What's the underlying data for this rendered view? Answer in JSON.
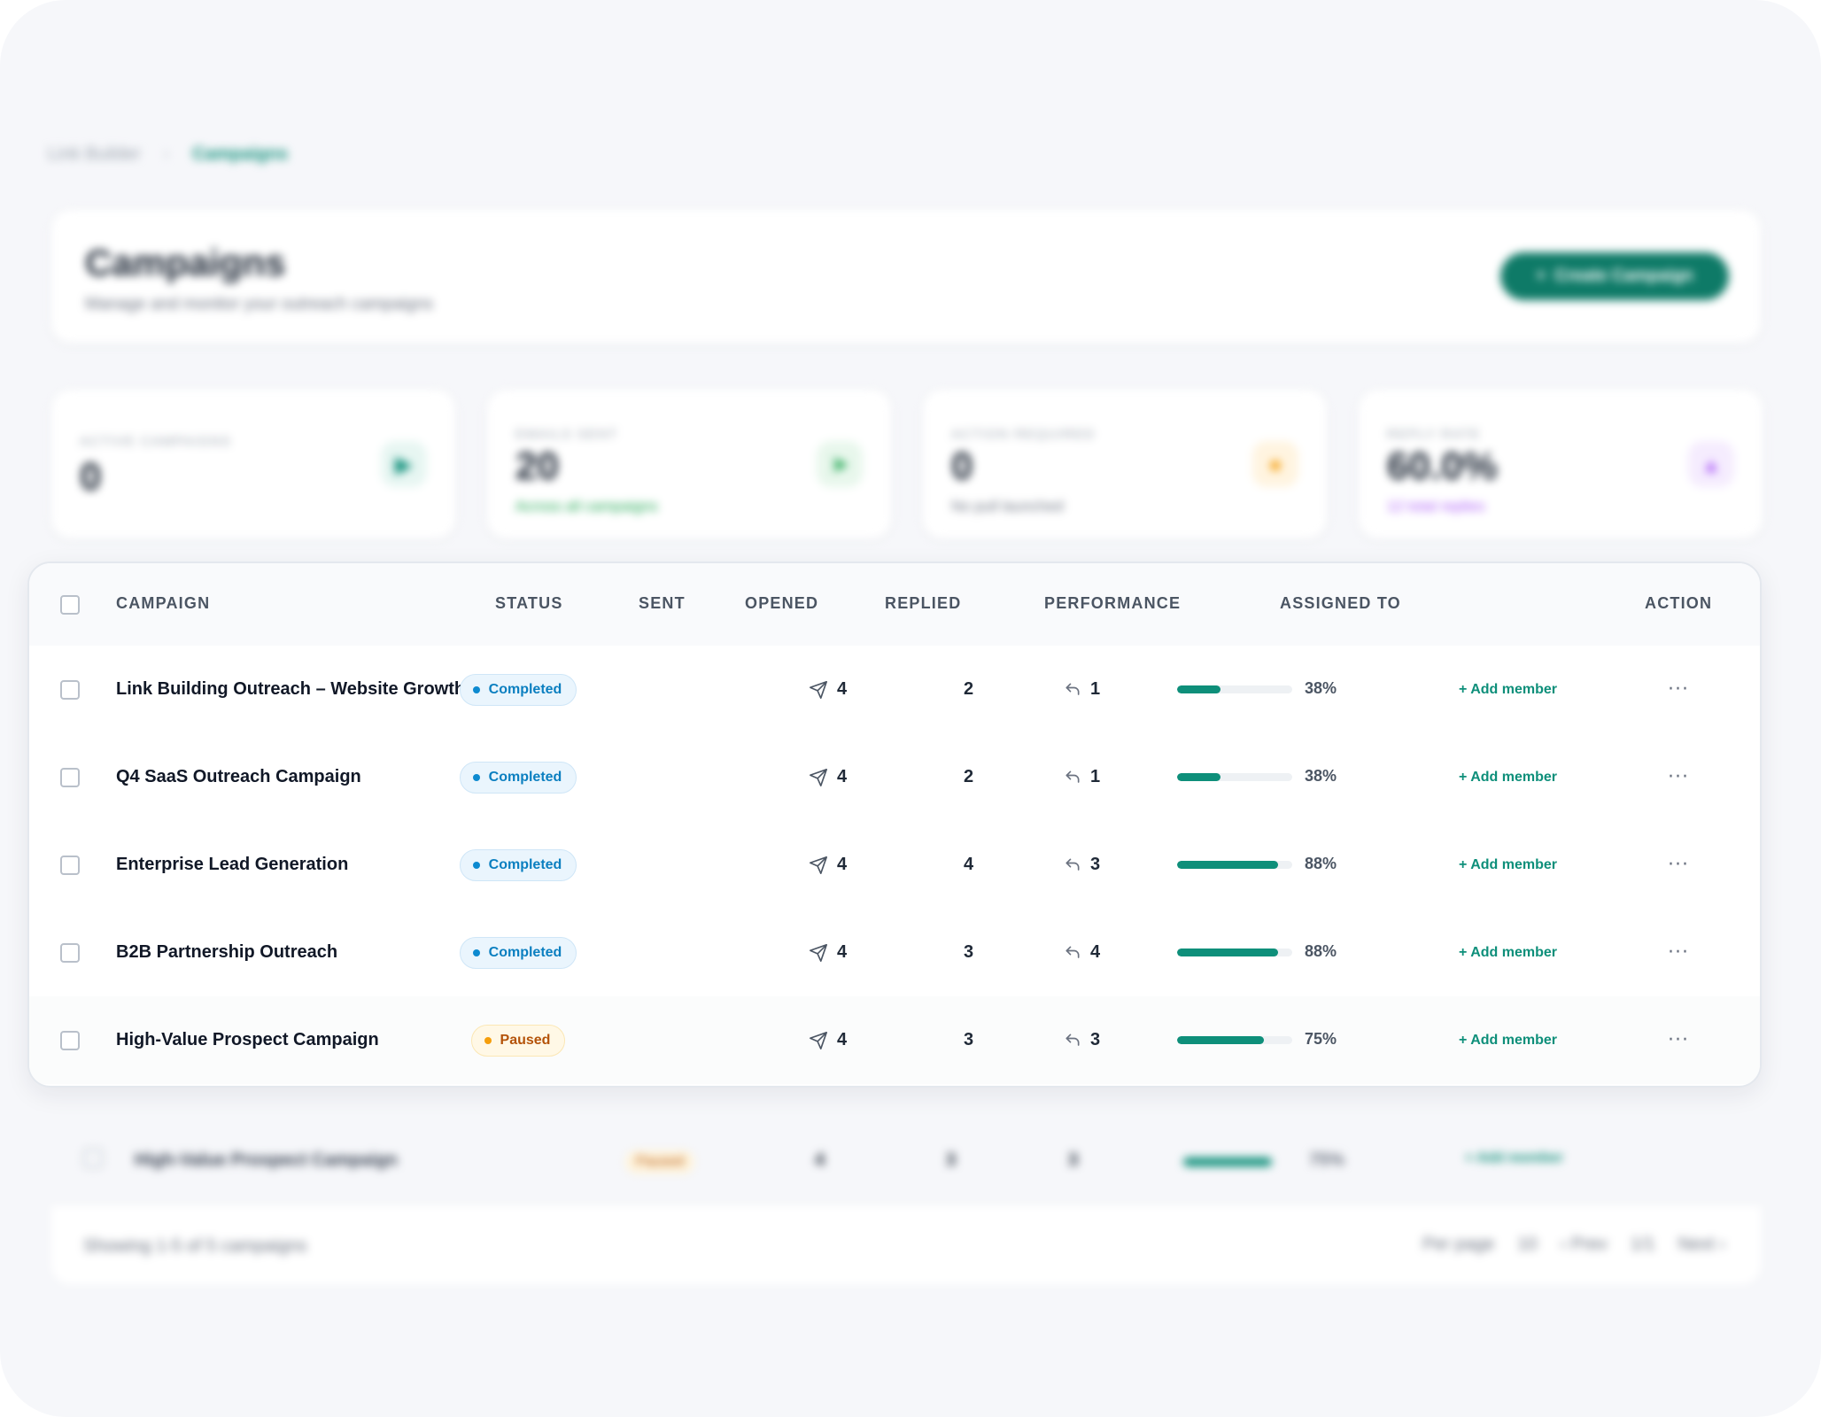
{
  "breadcrumb": {
    "parent": "Link Builder",
    "separator": "›",
    "current": "Campaigns"
  },
  "header": {
    "title": "Campaigns",
    "subtitle": "Manage and monitor your outreach campaigns",
    "create_button": {
      "icon": "+",
      "label": "Create Campaign"
    }
  },
  "stats": [
    {
      "label": "ACTIVE CAMPAIGNS",
      "value": "0",
      "note": "",
      "icon": "play-icon",
      "color": "#0e8f7a",
      "bg": "#e7f6f2"
    },
    {
      "label": "EMAILS SENT",
      "value": "20",
      "note": "Across all campaigns",
      "icon": "send-icon",
      "color": "#16a34a",
      "bg": "#e8f7ec"
    },
    {
      "label": "ACTION REQUIRED",
      "value": "0",
      "note": "No pull launched",
      "icon": "alert-icon",
      "color": "#f59e0b",
      "bg": "#fff4e0"
    },
    {
      "label": "REPLY RATE",
      "value": "60.0%",
      "note": "12 total replies",
      "icon": "chart-icon",
      "color": "#a855f7",
      "bg": "#f5ecfe"
    }
  ],
  "table": {
    "headers": {
      "campaign": "CAMPAIGN",
      "status": "STATUS",
      "sent": "SENT",
      "opened": "OPENED",
      "replied": "REPLIED",
      "performance": "PERFORMANCE",
      "assigned": "ASSIGNED TO",
      "action": "ACTION"
    },
    "rows": [
      {
        "name": "Link Building Outreach – Website Growth",
        "status": "Completed",
        "sent": "4",
        "opened": "2",
        "replied": "1",
        "performance": 38,
        "performance_label": "38%",
        "assigned": "+ Add member",
        "action": "···"
      },
      {
        "name": "Q4 SaaS Outreach Campaign",
        "status": "Completed",
        "sent": "4",
        "opened": "2",
        "replied": "1",
        "performance": 38,
        "performance_label": "38%",
        "assigned": "+ Add member",
        "action": "···"
      },
      {
        "name": "Enterprise Lead Generation",
        "status": "Completed",
        "sent": "4",
        "opened": "4",
        "replied": "3",
        "performance": 88,
        "performance_label": "88%",
        "assigned": "+ Add member",
        "action": "···"
      },
      {
        "name": "B2B Partnership Outreach",
        "status": "Completed",
        "sent": "4",
        "opened": "3",
        "replied": "4",
        "performance": 88,
        "performance_label": "88%",
        "assigned": "+ Add member",
        "action": "···"
      },
      {
        "name": "High-Value Prospect Campaign",
        "status": "Paused",
        "sent": "4",
        "opened": "3",
        "replied": "3",
        "performance": 75,
        "performance_label": "75%",
        "assigned": "+ Add member",
        "action": "···"
      }
    ]
  },
  "background_row": {
    "name": "High-Value Prospect Campaign",
    "status": "Paused",
    "sent": "4",
    "opened": "3",
    "replied": "3",
    "performance_label": "75%",
    "assigned": "+ Add member"
  },
  "footer": {
    "showing": "Showing 1-5 of 5 campaigns",
    "per_page_label": "Per page",
    "per_page_value": "10",
    "prev": "‹ Prev",
    "page": "1/1",
    "next": "Next ›"
  },
  "colors": {
    "accent": "#0e8f7a",
    "completed": "#0b7fc0",
    "paused": "#b45309"
  }
}
